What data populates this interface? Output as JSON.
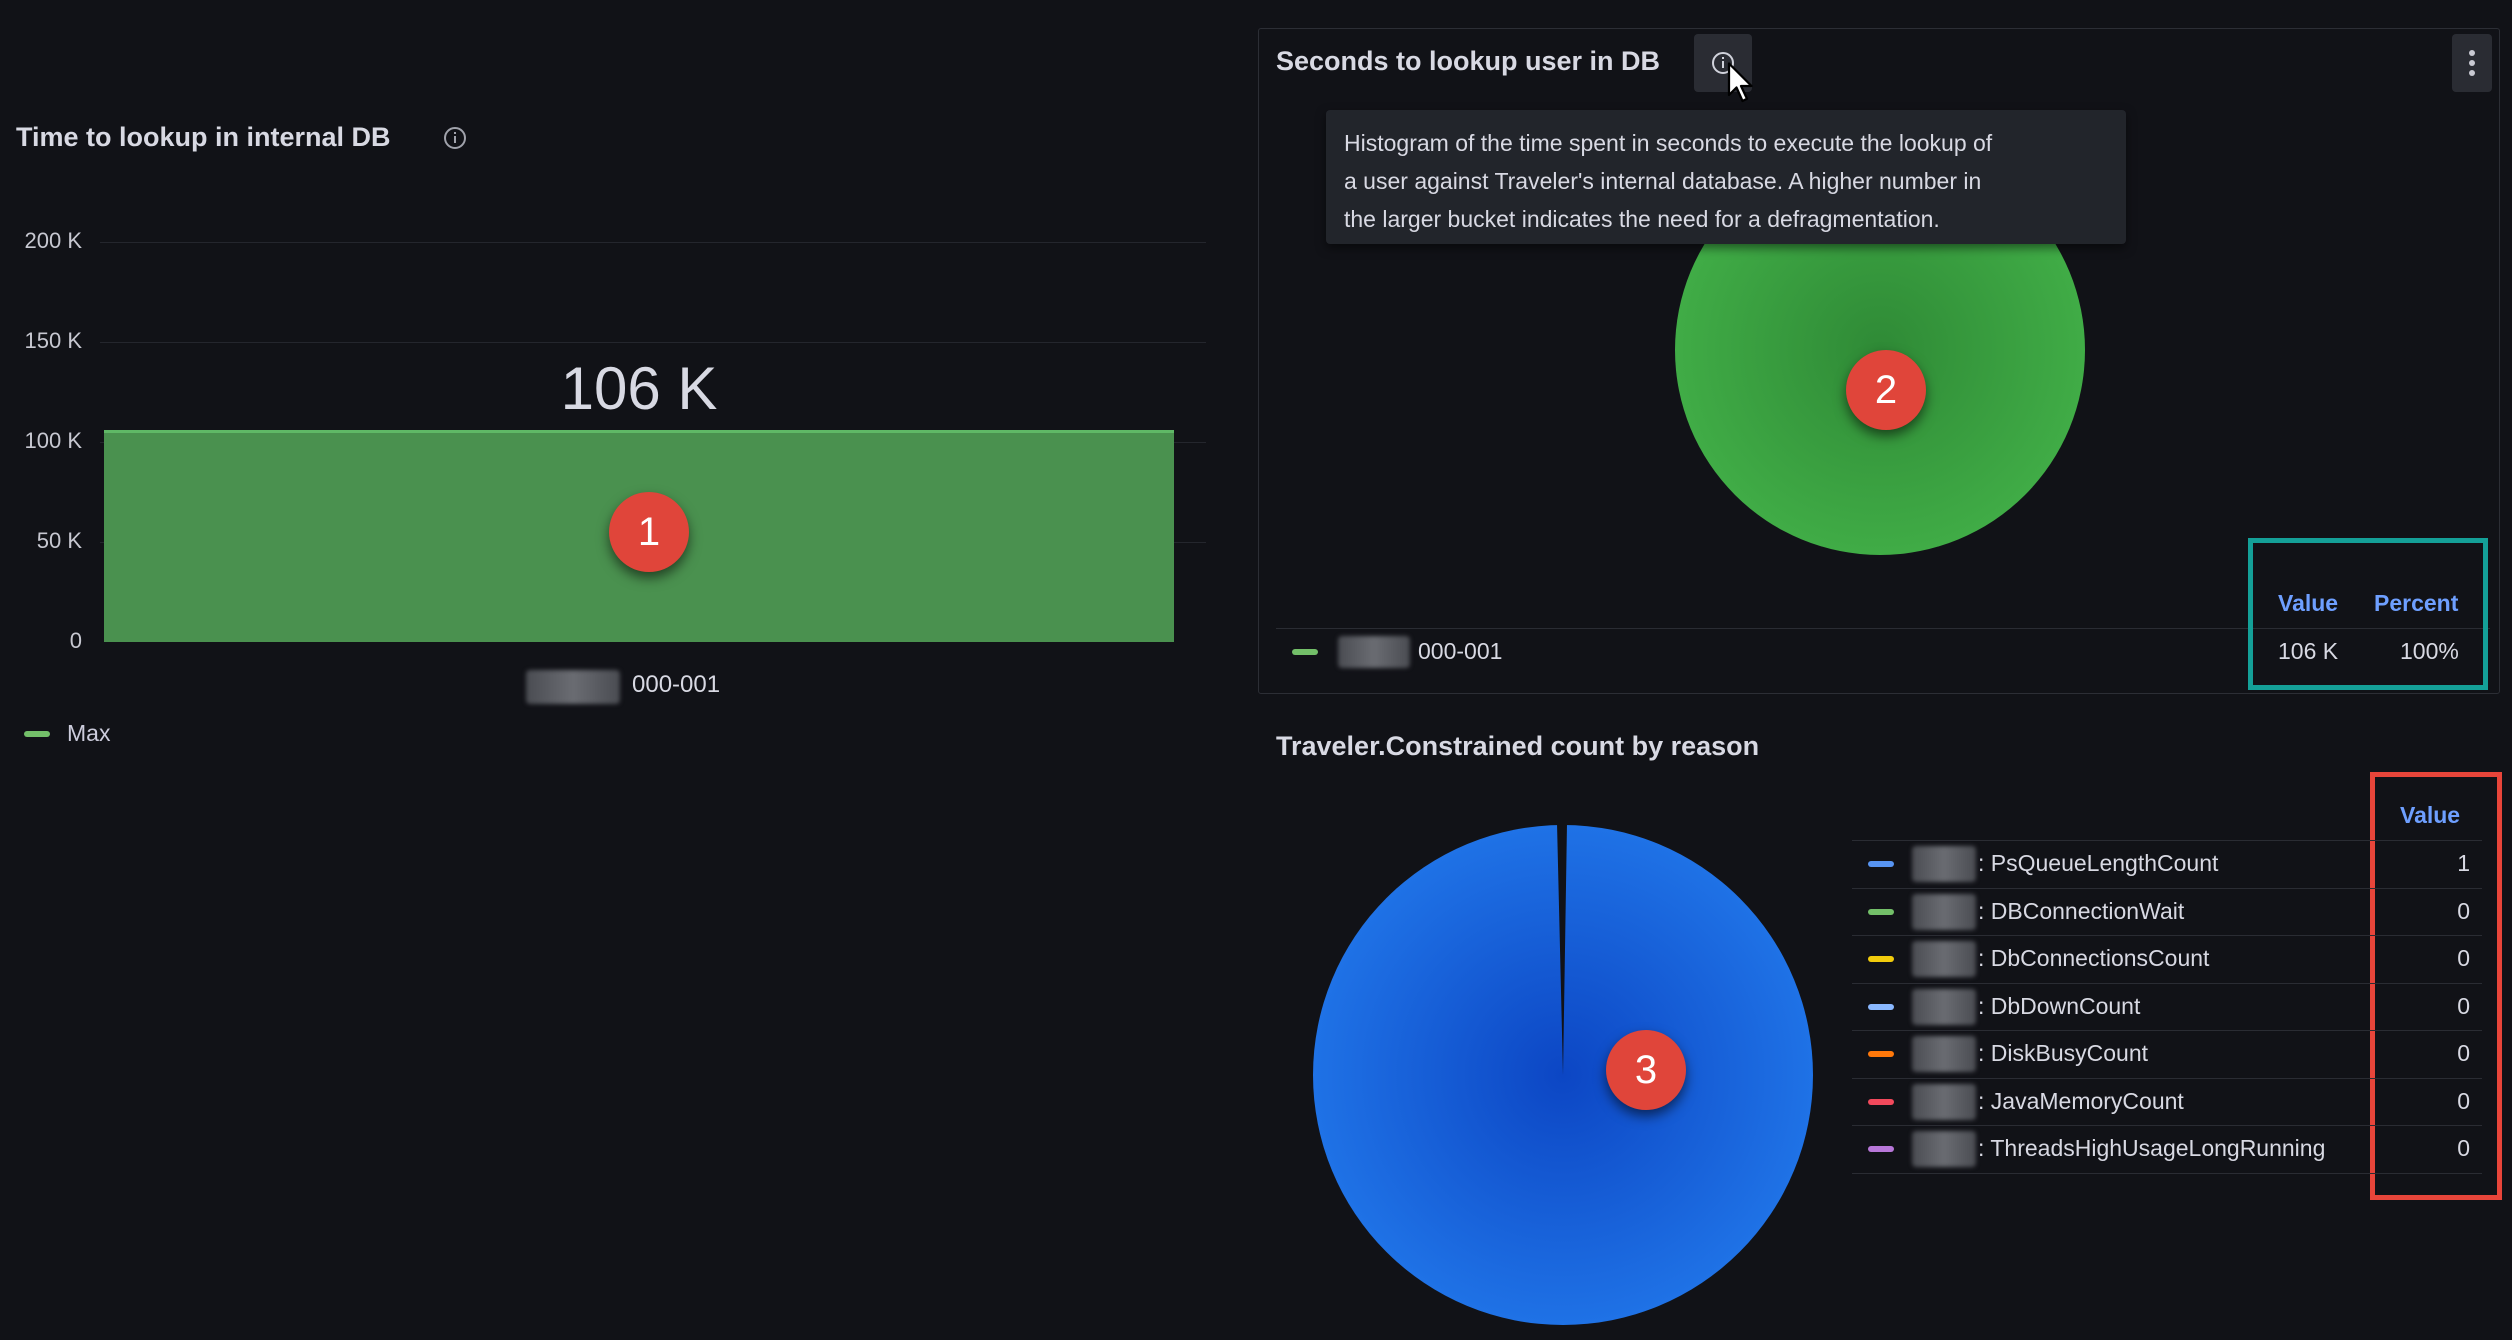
{
  "colors": {
    "background": "#111217",
    "bar_green": "#4a914f",
    "pie_green": "#37a040",
    "pie_blue": "#1f6fe0",
    "accent_blue": "#6e9fff",
    "marker_red": "#e0453a",
    "teal_box": "#14a098",
    "red_box": "#e8453a"
  },
  "left_panel": {
    "title": "Time to lookup in internal DB",
    "chart_data": {
      "type": "bar",
      "categories": [
        "000-001"
      ],
      "values": [
        106000
      ],
      "value_label": "106 K",
      "ylim": [
        0,
        200000
      ],
      "yticks": [
        "0",
        "50 K",
        "100 K",
        "150 K",
        "200 K"
      ],
      "legend": [
        "Max"
      ],
      "legend_position": "bottom-left",
      "grid": true
    },
    "category_label": "000-001",
    "legend_label": "Max",
    "marker": "1"
  },
  "histogram_panel": {
    "title": "Seconds to lookup user in DB",
    "tooltip": "Histogram of the time spent in seconds to execute the lookup of a user against Traveler's internal database. A higher number in the larger bucket indicates the need for a defragmentation.",
    "tooltip_lines": [
      "Histogram of the time spent in seconds to execute the lookup of",
      "a user against Traveler's internal database. A higher number in",
      "the larger bucket indicates the need for a defragmentation."
    ],
    "chart_data": {
      "type": "pie",
      "slices": [
        {
          "label": "000-001",
          "value": 106000,
          "percent": 100
        }
      ]
    },
    "legend_label": "000-001",
    "col_value": "Value",
    "col_percent": "Percent",
    "row_value": "106 K",
    "row_percent": "100%",
    "marker": "2",
    "menu_icon": "vertical-dots-icon"
  },
  "constrained_panel": {
    "title": "Traveler.Constrained count by reason",
    "col_value": "Value",
    "chart_data": {
      "type": "pie",
      "slices": [
        {
          "label": ": PsQueueLengthCount",
          "value": 1,
          "color": "#5794f2"
        },
        {
          "label": ": DBConnectionWait",
          "value": 0,
          "color": "#73bf69"
        },
        {
          "label": ": DbConnectionsCount",
          "value": 0,
          "color": "#f2cc0c"
        },
        {
          "label": ": DbDownCount",
          "value": 0,
          "color": "#8ab8ff"
        },
        {
          "label": ": DiskBusyCount",
          "value": 0,
          "color": "#ff780a"
        },
        {
          "label": ": JavaMemoryCount",
          "value": 0,
          "color": "#f2495c"
        },
        {
          "label": ": ThreadsHighUsageLongRunning",
          "value": 0,
          "color": "#b877d9"
        }
      ]
    },
    "rows": [
      {
        "label": ": PsQueueLengthCount",
        "value": "1",
        "color": "#5794f2"
      },
      {
        "label": ": DBConnectionWait",
        "value": "0",
        "color": "#73bf69"
      },
      {
        "label": ": DbConnectionsCount",
        "value": "0",
        "color": "#f2cc0c"
      },
      {
        "label": ": DbDownCount",
        "value": "0",
        "color": "#8ab8ff"
      },
      {
        "label": ": DiskBusyCount",
        "value": "0",
        "color": "#ff780a"
      },
      {
        "label": ": JavaMemoryCount",
        "value": "0",
        "color": "#f2495c"
      },
      {
        "label": ": ThreadsHighUsageLongRunning",
        "value": "0",
        "color": "#b877d9"
      }
    ],
    "marker": "3"
  }
}
